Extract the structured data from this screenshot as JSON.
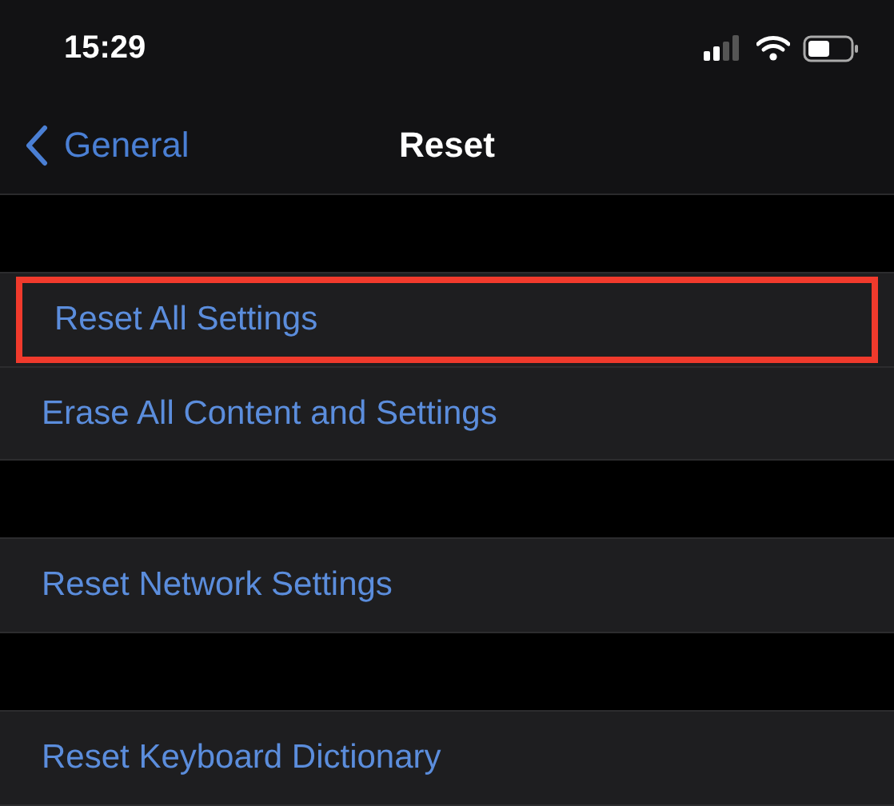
{
  "status_bar": {
    "time": "15:29"
  },
  "nav": {
    "back": "General",
    "title": "Reset"
  },
  "groups": [
    {
      "items": [
        {
          "label": "Reset All Settings",
          "highlighted": true
        },
        {
          "label": "Erase All Content and Settings",
          "highlighted": false
        }
      ]
    },
    {
      "items": [
        {
          "label": "Reset Network Settings",
          "highlighted": false
        }
      ]
    },
    {
      "items": [
        {
          "label": "Reset Keyboard Dictionary",
          "highlighted": false
        }
      ]
    }
  ]
}
